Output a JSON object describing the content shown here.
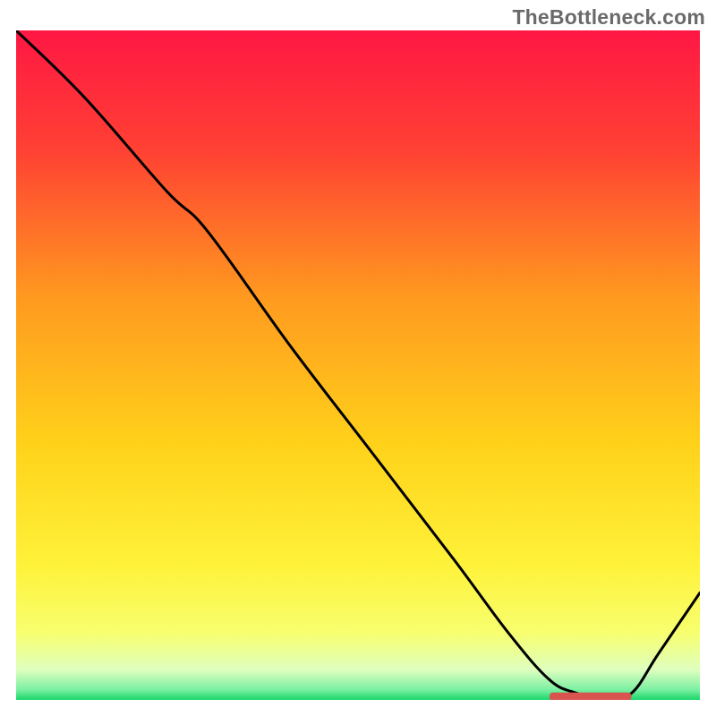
{
  "watermark": "TheBottleneck.com",
  "chart_data": {
    "type": "line",
    "title": "",
    "xlabel": "",
    "ylabel": "",
    "xlim": [
      0,
      100
    ],
    "ylim": [
      0,
      100
    ],
    "grid": false,
    "legend": false,
    "gradient_stops": [
      {
        "offset": 0.0,
        "color": "#ff1744"
      },
      {
        "offset": 0.18,
        "color": "#ff4133"
      },
      {
        "offset": 0.4,
        "color": "#ff9a1f"
      },
      {
        "offset": 0.62,
        "color": "#ffd21a"
      },
      {
        "offset": 0.8,
        "color": "#fff23a"
      },
      {
        "offset": 0.9,
        "color": "#f7ff6f"
      },
      {
        "offset": 0.955,
        "color": "#dfffbf"
      },
      {
        "offset": 0.985,
        "color": "#7af0a2"
      },
      {
        "offset": 1.0,
        "color": "#18d66a"
      }
    ],
    "series": [
      {
        "name": "bottleneck-curve",
        "x": [
          0,
          10,
          22,
          28,
          40,
          52,
          64,
          72,
          78,
          82,
          86,
          90,
          94,
          100
        ],
        "y": [
          100,
          90,
          76,
          70,
          53,
          37,
          21,
          10,
          3,
          1,
          0,
          1,
          7,
          16
        ]
      }
    ],
    "marker": {
      "name": "optimal-range",
      "x_start": 78,
      "x_end": 90,
      "y": 0.5,
      "color": "#d9534f"
    }
  }
}
